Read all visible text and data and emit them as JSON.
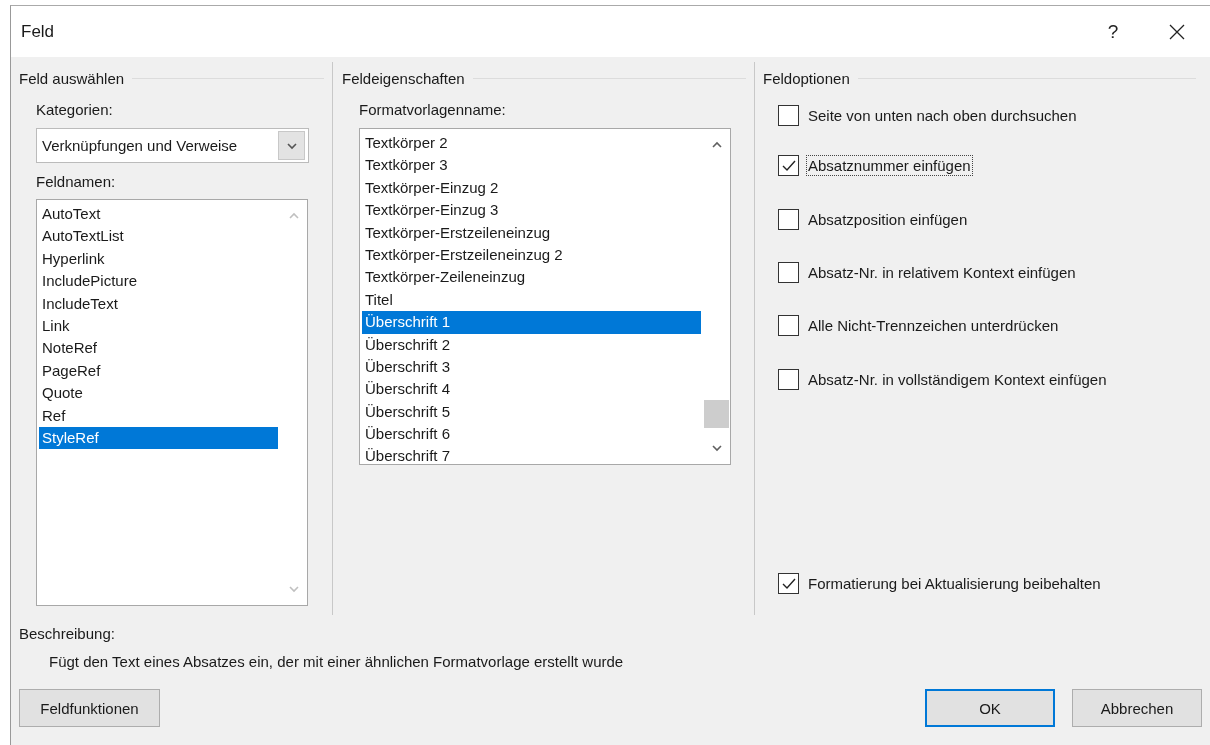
{
  "window": {
    "title": "Feld",
    "help": "?"
  },
  "select_field": {
    "heading": "Feld auswählen",
    "categories_label": "Kategorien:",
    "categories_value": "Verknüpfungen und Verweise",
    "names_label": "Feldnamen:",
    "names": [
      {
        "label": "AutoText",
        "selected": false
      },
      {
        "label": "AutoTextList",
        "selected": false
      },
      {
        "label": "Hyperlink",
        "selected": false
      },
      {
        "label": "IncludePicture",
        "selected": false
      },
      {
        "label": "IncludeText",
        "selected": false
      },
      {
        "label": "Link",
        "selected": false
      },
      {
        "label": "NoteRef",
        "selected": false
      },
      {
        "label": "PageRef",
        "selected": false
      },
      {
        "label": "Quote",
        "selected": false
      },
      {
        "label": "Ref",
        "selected": false
      },
      {
        "label": "StyleRef",
        "selected": true
      }
    ]
  },
  "field_properties": {
    "heading": "Feldeigenschaften",
    "style_name_label": "Formatvorlagenname:",
    "styles": [
      {
        "label": "Textkörper 2",
        "selected": false
      },
      {
        "label": "Textkörper 3",
        "selected": false
      },
      {
        "label": "Textkörper-Einzug 2",
        "selected": false
      },
      {
        "label": "Textkörper-Einzug 3",
        "selected": false
      },
      {
        "label": "Textkörper-Erstzeileneinzug",
        "selected": false
      },
      {
        "label": "Textkörper-Erstzeileneinzug 2",
        "selected": false
      },
      {
        "label": "Textkörper-Zeileneinzug",
        "selected": false
      },
      {
        "label": "Titel",
        "selected": false
      },
      {
        "label": "Überschrift 1",
        "selected": true
      },
      {
        "label": "Überschrift 2",
        "selected": false
      },
      {
        "label": "Überschrift 3",
        "selected": false
      },
      {
        "label": "Überschrift 4",
        "selected": false
      },
      {
        "label": "Überschrift 5",
        "selected": false
      },
      {
        "label": "Überschrift 6",
        "selected": false
      },
      {
        "label": "Überschrift 7",
        "selected": false
      }
    ]
  },
  "field_options": {
    "heading": "Feldoptionen",
    "options": [
      {
        "label": "Seite von unten nach oben durchsuchen",
        "checked": false,
        "focused": false
      },
      {
        "label": "Absatznummer einfügen",
        "checked": true,
        "focused": true
      },
      {
        "label": "Absatzposition einfügen",
        "checked": false,
        "focused": false
      },
      {
        "label": "Absatz-Nr. in relativem Kontext einfügen",
        "checked": false,
        "focused": false
      },
      {
        "label": "Alle Nicht-Trennzeichen unterdrücken",
        "checked": false,
        "focused": false
      },
      {
        "label": "Absatz-Nr. in vollständigem Kontext einfügen",
        "checked": false,
        "focused": false
      }
    ],
    "keep_formatting": {
      "label": "Formatierung bei Aktualisierung beibehalten",
      "checked": true,
      "focused": false
    }
  },
  "description": {
    "label": "Beschreibung:",
    "text": "Fügt den Text eines Absatzes ein, der mit einer ähnlichen Formatvorlage erstellt wurde"
  },
  "buttons": [
    {
      "label": "Feldfunktionen",
      "kind": "left"
    },
    {
      "label": "OK",
      "kind": "default"
    },
    {
      "label": "Abbrechen",
      "kind": "normal"
    }
  ]
}
